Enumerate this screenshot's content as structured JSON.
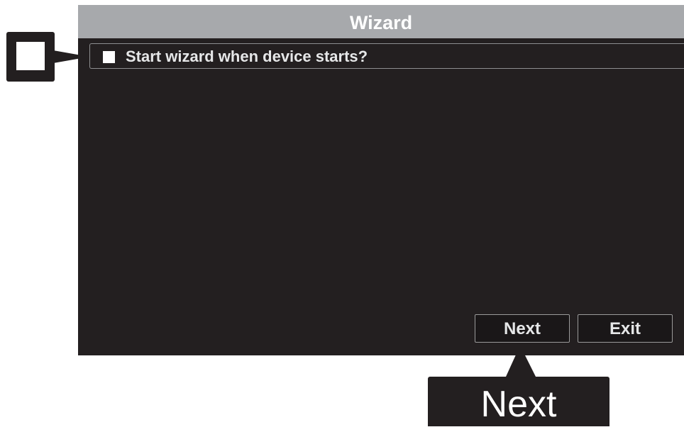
{
  "dialog": {
    "title": "Wizard",
    "option": {
      "label": "Start wizard when device starts?",
      "checked": false
    },
    "buttons": {
      "next_label": "Next",
      "exit_label": "Exit"
    }
  },
  "annotations": {
    "checkbox_callout_icon": "checkbox-icon",
    "next_callout_label": "Next"
  },
  "colors": {
    "dialog_background": "#231f20",
    "titlebar_background": "#a7a9ac",
    "text": "#e6e7e8"
  }
}
